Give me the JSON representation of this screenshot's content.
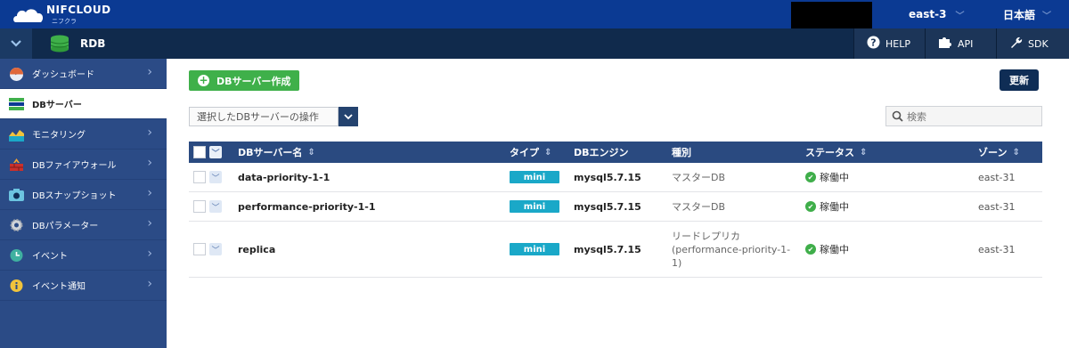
{
  "header": {
    "brand": "NIFCLOUD",
    "brand_sub": "ニフクラ",
    "region": "east-3",
    "language": "日本語"
  },
  "subbar": {
    "service": "RDB",
    "help": "HELP",
    "api": "API",
    "sdk": "SDK"
  },
  "sidebar": {
    "items": [
      {
        "label": "ダッシュボード",
        "icon": "dashboard-icon"
      },
      {
        "label": "DBサーバー",
        "icon": "db-server-icon"
      },
      {
        "label": "モニタリング",
        "icon": "monitoring-icon"
      },
      {
        "label": "DBファイアウォール",
        "icon": "firewall-icon"
      },
      {
        "label": "DBスナップショット",
        "icon": "camera-icon"
      },
      {
        "label": "DBパラメーター",
        "icon": "gear-icon"
      },
      {
        "label": "イベント",
        "icon": "clock-icon"
      },
      {
        "label": "イベント通知",
        "icon": "info-icon"
      }
    ]
  },
  "toolbar": {
    "create": "DBサーバー作成",
    "update": "更新",
    "ops_select": "選択したDBサーバーの操作",
    "search_placeholder": "検索"
  },
  "table": {
    "headers": {
      "name": "DBサーバー名",
      "type": "タイプ",
      "engine": "DBエンジン",
      "kind": "種別",
      "status": "ステータス",
      "zone": "ゾーン"
    },
    "rows": [
      {
        "name": "data-priority-1-1",
        "type": "mini",
        "engine": "mysql5.7.15",
        "kind": "マスターDB",
        "status": "稼働中",
        "zone": "east-31"
      },
      {
        "name": "performance-priority-1-1",
        "type": "mini",
        "engine": "mysql5.7.15",
        "kind": "マスターDB",
        "status": "稼働中",
        "zone": "east-31"
      },
      {
        "name": "replica",
        "type": "mini",
        "engine": "mysql5.7.15",
        "kind": "リードレプリカ",
        "kind_line2": "(performance-priority-1-",
        "kind_line3": "1)",
        "status": "稼働中",
        "zone": "east-31"
      }
    ]
  }
}
